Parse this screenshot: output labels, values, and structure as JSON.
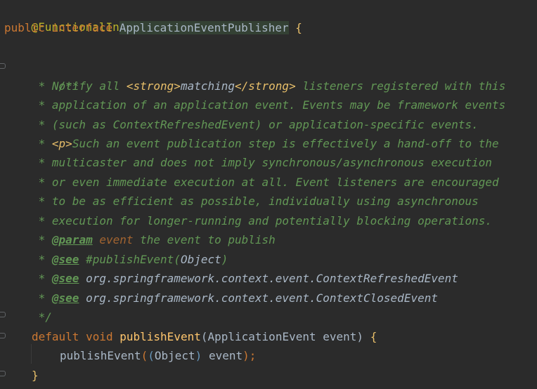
{
  "code": {
    "annotation": "@FunctionalInterface",
    "decl": {
      "kw_public": "public",
      "kw_interface": "interface",
      "name": "ApplicationEventPublisher",
      "open_brace": "{"
    },
    "javadoc": {
      "open": "/**",
      "l1_star": " * ",
      "l1_a": "Notify all ",
      "l1_strong_open": "<strong>",
      "l1_b": "matching",
      "l1_strong_close": "</strong>",
      "l1_c": " listeners registered with this",
      "l2": " * application of an application event. Events may be framework events",
      "l3": " * (such as ContextRefreshedEvent) or application-specific events.",
      "l4_star": " * ",
      "l4_p": "<p>",
      "l4_text": "Such an event publication step is effectively a hand-off to the",
      "l5": " * multicaster and does not imply synchronous/asynchronous execution",
      "l6": " * or even immediate execution at all. Event listeners are encouraged",
      "l7": " * to be as efficient as possible, individually using asynchronous",
      "l8": " * execution for longer-running and potentially blocking operations.",
      "param_star": " * ",
      "param_tag": "@param",
      "param_name": " event",
      "param_desc": " the event to publish",
      "see1_star": " * ",
      "see1_tag": "@see",
      "see1_a": " #publishEvent(",
      "see1_ref": "Object",
      "see1_b": ")",
      "see2_star": " * ",
      "see2_tag": "@see",
      "see2_ref": " org.springframework.context.event.ContextRefreshedEvent",
      "see3_star": " * ",
      "see3_tag": "@see",
      "see3_ref": " org.springframework.context.event.ContextClosedEvent",
      "close": " */"
    },
    "method": {
      "kw_default": "default",
      "kw_void": "void",
      "name": "publishEvent",
      "open_paren": "(",
      "param_type": "ApplicationEvent",
      "param_name": " event",
      "close_paren": ")",
      "open_brace": "{"
    },
    "body": {
      "call": "publishEvent",
      "p1": "(",
      "p2": "(",
      "cast": "Object",
      "p3": ")",
      "arg": " event",
      "p4": ")",
      "semi": ";"
    },
    "method_close": "}"
  },
  "colors": {
    "background": "#2b2b2b",
    "keyword": "#cc7832",
    "annotation": "#bbb529",
    "doc_comment": "#629755",
    "method_decl": "#ffc66d",
    "default_text": "#a9b7c6"
  }
}
